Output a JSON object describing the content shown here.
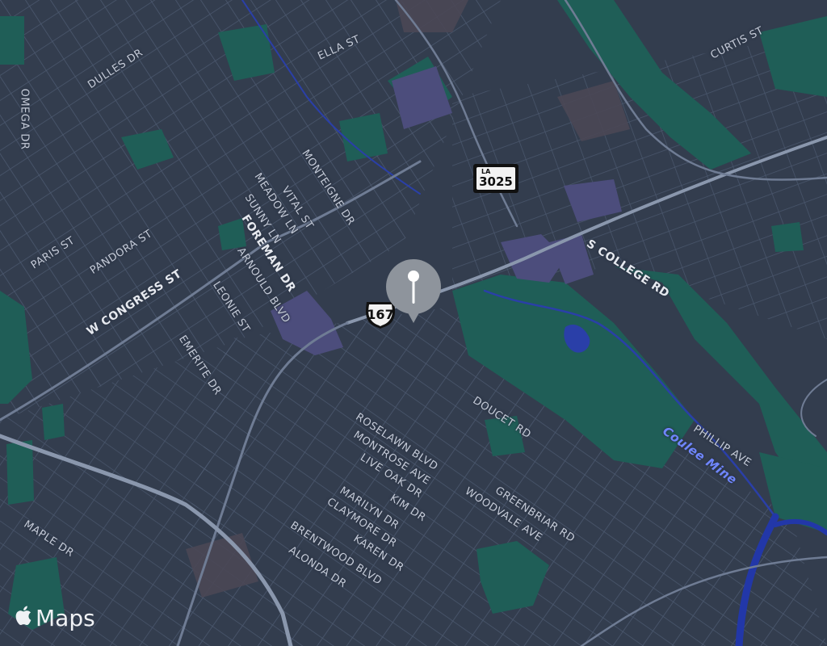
{
  "map": {
    "colors": {
      "land": "#333d4e",
      "street": "#56637b",
      "major_road": "#8a97ad",
      "park": "#1f5e57",
      "building_zone": "#4b4f79",
      "water": "#2a3fa8"
    },
    "pin": {
      "icon": "location-pin-icon"
    },
    "shields": {
      "us_route": "167",
      "state_route_prefix": "LA",
      "state_route": "3025"
    },
    "water_labels": [
      "Coulee Mine"
    ],
    "road_labels": {
      "ella_st": "ELLA ST",
      "curtis_st": "CURTIS ST",
      "dulles_dr": "DULLES DR",
      "omega_dr": "OMEGA DR",
      "monteigne_dr": "MONTEIGNE DR",
      "vital_st": "VITAL ST",
      "meadow_ln": "MEADOW LN",
      "sunny_ln": "SUNNY LN",
      "foreman_dr": "FOREMAN DR",
      "arnould_blvd": "ARNOULD BLVD",
      "paris_st": "PARIS ST",
      "pandora_st": "PANDORA ST",
      "w_congress_st": "W CONGRESS ST",
      "leonie_st": "LEONIE ST",
      "emerite_dr": "EMERITE DR",
      "s_college_rd": "S COLLEGE RD",
      "doucet_rd": "DOUCET RD",
      "roselawn_blvd": "ROSELAWN BLVD",
      "montrose_ave": "MONTROSE AVE",
      "live_oak_dr": "LIVE OAK DR",
      "kim_dr": "KIM DR",
      "marilyn_dr": "MARILYN DR",
      "claymore_dr": "CLAYMORE DR",
      "karen_dr": "KAREN DR",
      "brentwood_blvd": "BRENTWOOD BLVD",
      "alonda_dr": "ALONDA DR",
      "greenbriar_rd": "GREENBRIAR RD",
      "woodvale_ave": "WOODVALE AVE",
      "phillip_ave": "PHILLIP AVE",
      "maple_dr": "MAPLE DR"
    }
  },
  "attribution": {
    "logo_icon": "apple-logo-icon",
    "label": "Maps"
  }
}
